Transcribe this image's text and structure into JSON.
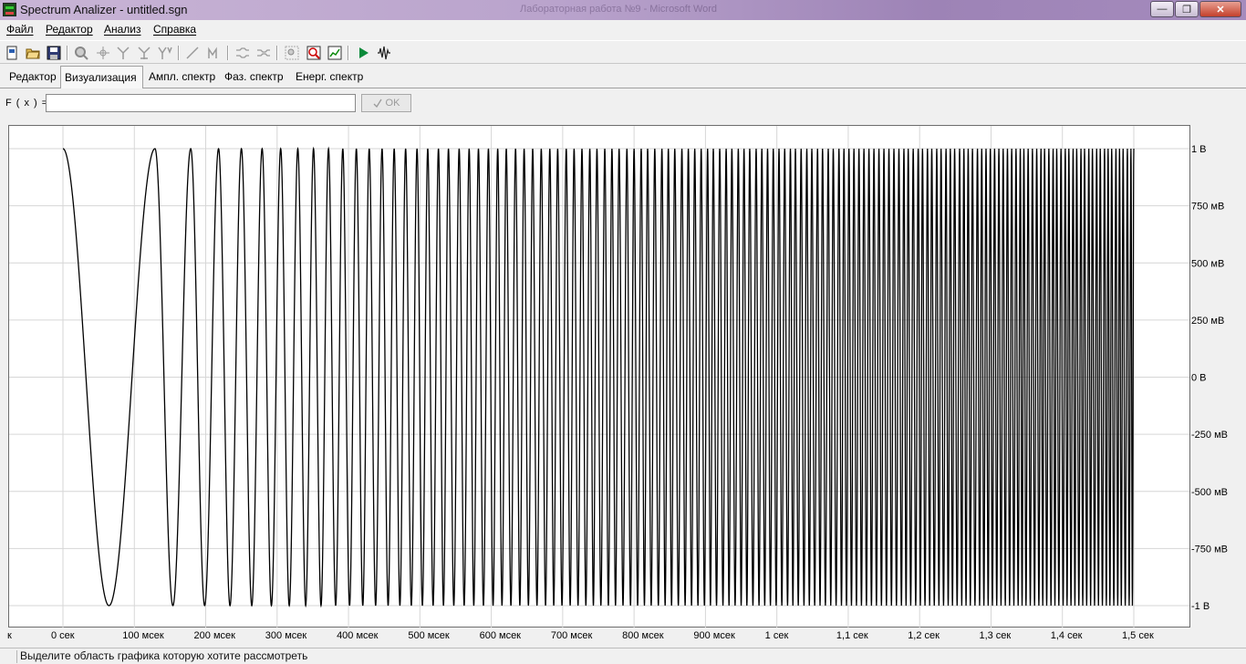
{
  "window": {
    "title": "Spectrum Analizer - untitled.sgn",
    "background_title": "Лабораторная работа №9 - Microsoft Word",
    "minimize_label": "—",
    "maximize_label": "❐",
    "close_label": "✕"
  },
  "menu": [
    {
      "label": "Файл"
    },
    {
      "label": "Редактор"
    },
    {
      "label": "Анализ"
    },
    {
      "label": "Справка"
    }
  ],
  "toolbar": {
    "icons": [
      "new-file-icon",
      "open-folder-icon",
      "save-icon",
      "zoom-icon",
      "move-point-icon",
      "select-marker-icon",
      "select-markers-icon",
      "multi-marker-icon",
      "line-tool-icon",
      "curve-tool-icon",
      "filter-icon",
      "filter-2-icon",
      "zoom-region-icon",
      "zoom-chart-icon",
      "chart-icon",
      "play-icon",
      "waveform-icon"
    ]
  },
  "tabs": [
    {
      "label": "Редактор",
      "active": false
    },
    {
      "label": "Визуализация",
      "active": true
    },
    {
      "label": "Ампл. спектр",
      "active": false
    },
    {
      "label": "Фаз. спектр",
      "active": false
    },
    {
      "label": "Енерг. спектр",
      "active": false
    }
  ],
  "formula": {
    "label": "F ( x ) =",
    "value": "",
    "ok_label": "OK"
  },
  "chart_data": {
    "type": "line",
    "description_signal": "chirp",
    "xlim": [
      0,
      1.5
    ],
    "ylim": [
      -1,
      1
    ],
    "x_ticks": [
      {
        "value": 0,
        "label": "0 сек"
      },
      {
        "value": 0.1,
        "label": "100 мсек"
      },
      {
        "value": 0.2,
        "label": "200 мсек"
      },
      {
        "value": 0.3,
        "label": "300 мсек"
      },
      {
        "value": 0.4,
        "label": "400 мсек"
      },
      {
        "value": 0.5,
        "label": "500 мсек"
      },
      {
        "value": 0.6,
        "label": "600 мсек"
      },
      {
        "value": 0.7,
        "label": "700 мсек"
      },
      {
        "value": 0.8,
        "label": "800 мсек"
      },
      {
        "value": 0.9,
        "label": "900 мсек"
      },
      {
        "value": 1.0,
        "label": "1 сек"
      },
      {
        "value": 1.1,
        "label": "1,1 сек"
      },
      {
        "value": 1.2,
        "label": "1,2 сек"
      },
      {
        "value": 1.3,
        "label": "1,3 сек"
      },
      {
        "value": 1.4,
        "label": "1,4 сек"
      },
      {
        "value": 1.5,
        "label": "1,5 сек"
      }
    ],
    "x_axis_start_label": "к",
    "y_ticks": [
      {
        "value": 1,
        "label": "1 В"
      },
      {
        "value": 0.75,
        "label": "750 мВ"
      },
      {
        "value": 0.5,
        "label": "500 мВ"
      },
      {
        "value": 0.25,
        "label": "250 мВ"
      },
      {
        "value": 0,
        "label": "0 В"
      },
      {
        "value": -0.25,
        "label": "-250 мВ"
      },
      {
        "value": -0.5,
        "label": "-500 мВ"
      },
      {
        "value": -0.75,
        "label": "-750 мВ"
      },
      {
        "value": -1,
        "label": "-1 В"
      }
    ],
    "series": [
      {
        "color": "#000000",
        "amplitude": 1,
        "x_start": 0,
        "x_end": 1.5,
        "peak_times": [
          0.0,
          0.129,
          0.179,
          0.218,
          0.25,
          0.279,
          0.305,
          0.329,
          0.351,
          0.372,
          0.392,
          0.411,
          0.429,
          0.447,
          0.464,
          0.48,
          0.496,
          0.511,
          0.526,
          0.54,
          0.555,
          0.569,
          0.582,
          0.596,
          0.609,
          0.621,
          0.634,
          0.646,
          0.658,
          0.67,
          0.682,
          0.693,
          0.705,
          0.716,
          0.727,
          0.738,
          0.748,
          0.759,
          0.769,
          0.779,
          0.79,
          0.8,
          0.81,
          0.819,
          0.829,
          0.839,
          0.848,
          0.857,
          0.867,
          0.876,
          0.885,
          0.894,
          0.903,
          0.911,
          0.92,
          0.929,
          0.937,
          0.946,
          0.954,
          0.962,
          0.971,
          0.979,
          0.987,
          0.995,
          1.003,
          1.011,
          1.019,
          1.026,
          1.034,
          1.042,
          1.049,
          1.057,
          1.064,
          1.072,
          1.079,
          1.087,
          1.094,
          1.101,
          1.108,
          1.115,
          1.122,
          1.129,
          1.136,
          1.143,
          1.15,
          1.157,
          1.164,
          1.171,
          1.178,
          1.184,
          1.191,
          1.198,
          1.204,
          1.211,
          1.217,
          1.224,
          1.23,
          1.237,
          1.243,
          1.249,
          1.256,
          1.262,
          1.268,
          1.274,
          1.281,
          1.287,
          1.293,
          1.299,
          1.305,
          1.311,
          1.317,
          1.323,
          1.329,
          1.335,
          1.341,
          1.346,
          1.352,
          1.358,
          1.364,
          1.37,
          1.375,
          1.381,
          1.387,
          1.392,
          1.398,
          1.404,
          1.409,
          1.415,
          1.42,
          1.426,
          1.431,
          1.437,
          1.442,
          1.448,
          1.453,
          1.459,
          1.464,
          1.469,
          1.475,
          1.48,
          1.485,
          1.491,
          1.496,
          1.5
        ]
      }
    ]
  },
  "status": {
    "text": "Выделите область графика которую хотите рассмотреть"
  }
}
